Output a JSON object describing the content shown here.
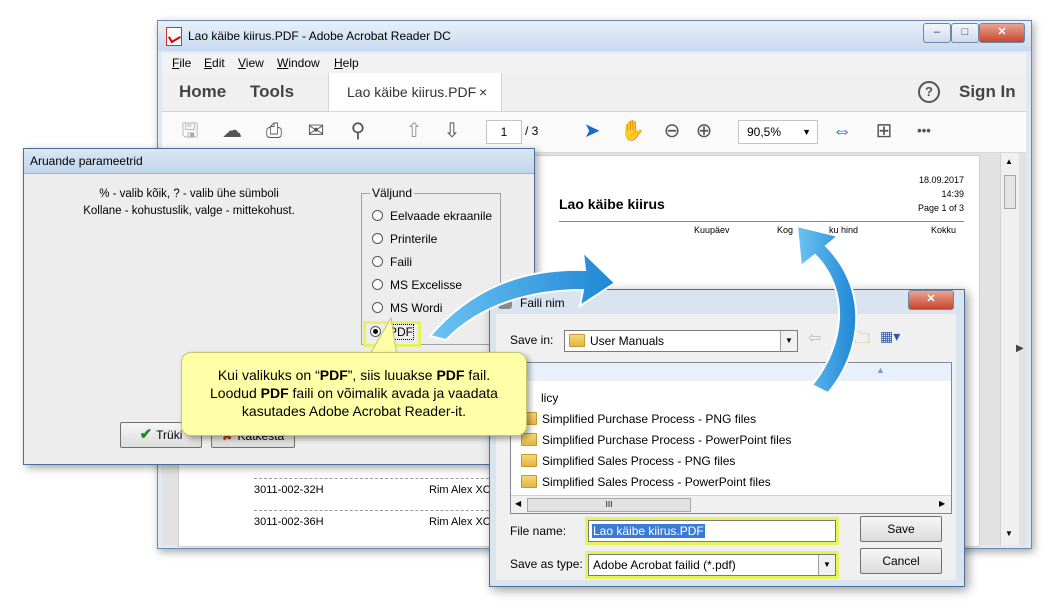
{
  "colors": {
    "accent_blue": "#1b6ac9",
    "highlight_yellow": "#e7f35a",
    "callout_bg": "#ffffa8",
    "arrow_blue": "#3aa3e3"
  },
  "acrobat": {
    "title": "Lao käibe kiirus.PDF - Adobe Acrobat Reader DC",
    "win_controls": [
      "–",
      "□",
      "✕"
    ],
    "menu": [
      "File",
      "Edit",
      "View",
      "Window",
      "Help"
    ],
    "nav": {
      "home": "Home",
      "tools": "Tools",
      "doc_tab": "Lao käibe kiirus.PDF",
      "tab_close": "×",
      "help_icon": "?",
      "sign_in": "Sign In"
    },
    "toolbar": {
      "page_current": "1",
      "page_total": "/ 3",
      "zoom": "90,5%",
      "more": "•••"
    },
    "doc": {
      "title": "Lao käibe kiirus",
      "date": "18.09.2017",
      "time": "14:39",
      "page_of": "Page 1 of 3",
      "col_date": "Kuupäev",
      "col_kog": "Kog",
      "col_price": "ku hind",
      "col_total": "Kokku",
      "rows": [
        {
          "code": "3011-002-32H",
          "name": "Rim Alex XC"
        },
        {
          "code": "3011-002-36H",
          "name": "Rim Alex XC"
        }
      ]
    }
  },
  "report_dialog": {
    "title": "Aruande parameetrid",
    "hint_line1": "% - valib kõik, ? - valib ühe sümboli",
    "hint_line2": "Kollane - kohustuslik, valge - mittekohust.",
    "output_group": "Väljund",
    "options": [
      "Eelvaade ekraanile",
      "Printerile",
      "Faili",
      "MS Excelisse",
      "MS Wordi",
      "PDF"
    ],
    "selected_option": "PDF",
    "print_button": "Trüki",
    "cancel_button": "Katkesta"
  },
  "save_dialog": {
    "title": "Faili nim",
    "close": "✕",
    "save_in_label": "Save in:",
    "save_in_value": "User Manuals",
    "files": [
      "licy",
      "Simplified Purchase Process - PNG files",
      "Simplified Purchase Process - PowerPoint files",
      "Simplified Sales Process - PNG files",
      "Simplified Sales Process - PowerPoint files"
    ],
    "hscroll_grip": "III",
    "file_name_label": "File name:",
    "file_name_value": "Lao käibe kiirus.PDF",
    "save_type_label": "Save as type:",
    "save_type_value": "Adobe Acrobat failid (*.pdf)",
    "save_button": "Save",
    "cancel_button": "Cancel"
  },
  "callout": {
    "line1_pre": "Kui valikuks on “",
    "line1_b1": "PDF",
    "line1_mid": "”, siis luuakse ",
    "line1_b2": "PDF",
    "line1_post": " fail.",
    "line2_pre": "Loodud ",
    "line2_b": "PDF",
    "line2_post": " faili on võimalik avada ja vaadata",
    "line3": "kasutades Adobe Acrobat Reader-it."
  }
}
